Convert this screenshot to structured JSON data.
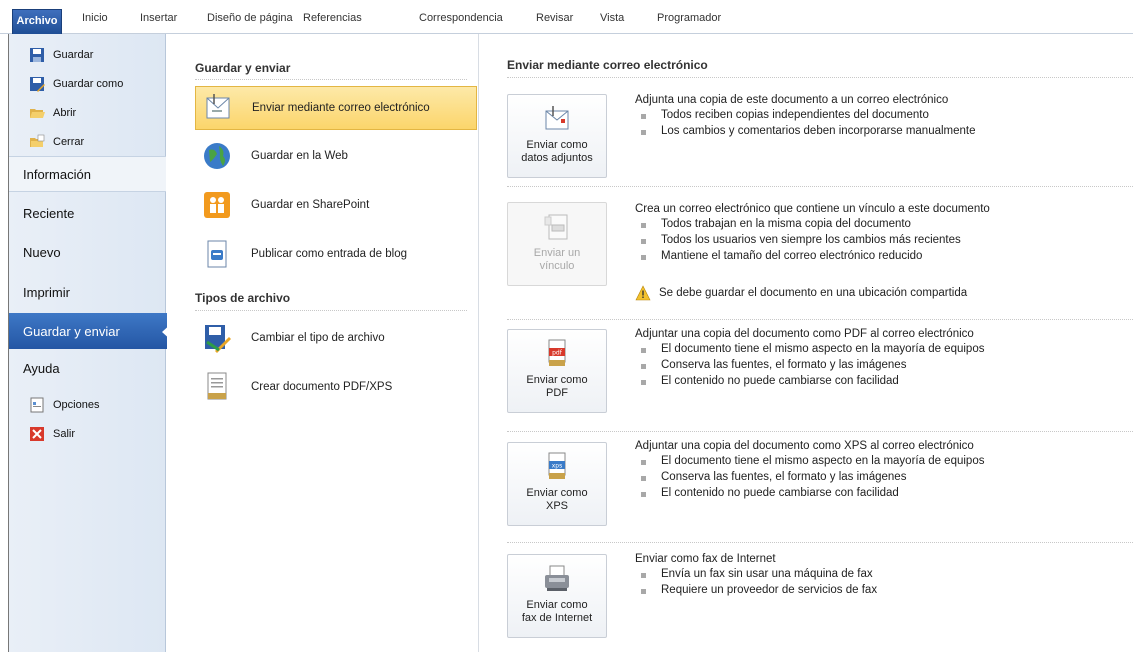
{
  "ribbon": {
    "tabs": [
      "Archivo",
      "Inicio",
      "Insertar",
      "Diseño de página",
      "Referencias",
      "Correspondencia",
      "Revisar",
      "Vista",
      "Programador"
    ]
  },
  "left_nav": {
    "small_top": [
      "Guardar",
      "Guardar como",
      "Abrir",
      "Cerrar"
    ],
    "big": [
      "Información",
      "Reciente",
      "Nuevo",
      "Imprimir",
      "Guardar y enviar",
      "Ayuda"
    ],
    "small_bottom": [
      "Opciones",
      "Salir"
    ]
  },
  "middle": {
    "section1_title": "Guardar y enviar",
    "section1_items": [
      "Enviar mediante correo electrónico",
      "Guardar en la Web",
      "Guardar en SharePoint",
      "Publicar como entrada de blog"
    ],
    "section2_title": "Tipos de archivo",
    "section2_items": [
      "Cambiar el tipo de archivo",
      "Crear documento PDF/XPS"
    ]
  },
  "right": {
    "title": "Enviar mediante correo electrónico",
    "options": [
      {
        "button": "Enviar como\ndatos adjuntos",
        "head": "Adjunta una copia de este documento a un correo electrónico",
        "bullets": [
          "Todos reciben copias independientes del documento",
          "Los cambios y comentarios deben incorporarse manualmente"
        ]
      },
      {
        "button": "Enviar un\nvínculo",
        "head": "Crea un correo electrónico que contiene un vínculo a este documento",
        "bullets": [
          "Todos trabajan en la misma copia del documento",
          "Todos los usuarios ven siempre los cambios más recientes",
          "Mantiene el tamaño del correo electrónico reducido"
        ],
        "warning": "Se debe guardar el documento en una ubicación compartida"
      },
      {
        "button": "Enviar como\nPDF",
        "head": "Adjuntar una copia del documento como PDF al correo electrónico",
        "bullets": [
          "El documento tiene el mismo aspecto en la mayoría de equipos",
          "Conserva las fuentes, el formato y las imágenes",
          "El contenido no puede cambiarse con facilidad"
        ]
      },
      {
        "button": "Enviar como\nXPS",
        "head": "Adjuntar una copia del documento como XPS al correo electrónico",
        "bullets": [
          "El documento tiene el mismo aspecto en la mayoría de equipos",
          "Conserva las fuentes, el formato y las imágenes",
          "El contenido no puede cambiarse con facilidad"
        ]
      },
      {
        "button": "Enviar como\nfax de Internet",
        "head": "Enviar como fax de Internet",
        "bullets": [
          "Envía un fax sin usar una máquina de fax",
          "Requiere un proveedor de servicios de fax"
        ]
      }
    ]
  }
}
